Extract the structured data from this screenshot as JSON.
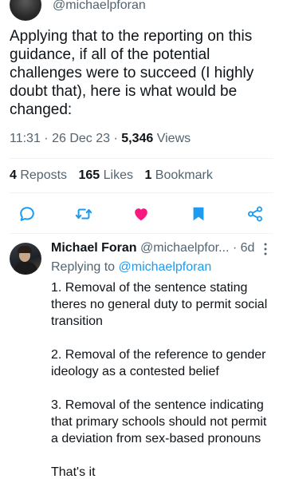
{
  "tweet": {
    "handle": "@michaelpforan",
    "text": "Applying that to the reporting on this guidance, if all of the potential challenges were to succeed (I highly doubt that), here is what would be changed:",
    "time": "11:31",
    "sep1": " · ",
    "date": "26 Dec 23",
    "sep2": " · ",
    "views_count": "5,346",
    "views_label": " Views"
  },
  "stats": {
    "reposts_count": "4",
    "reposts_label": " Reposts",
    "likes_count": "165",
    "likes_label": " Likes",
    "bookmarks_count": "1",
    "bookmarks_label": " Bookmark"
  },
  "actions": {
    "liked": true,
    "bookmarked": true,
    "icons": [
      "reply-icon",
      "repost-icon",
      "like-icon",
      "bookmark-icon",
      "share-icon"
    ],
    "colors": {
      "icon": "#1d9bf0",
      "like": "#f91880",
      "bookmark": "#1d9bf0"
    }
  },
  "reply": {
    "name": "Michael Foran",
    "handle": " @michaelpfor...",
    "time": " · 6d",
    "replying_prefix": "Replying to ",
    "replying_to": "@michaelpforan",
    "paragraphs": [
      "1. Removal of the sentence stating theres no general duty to permit social transition",
      "2. Removal of the reference to gender ideology as a contested belief",
      "3. Removal of the sentence indicating that primary schools should not permit a deviation from sex-based pronouns",
      "That's it"
    ]
  }
}
